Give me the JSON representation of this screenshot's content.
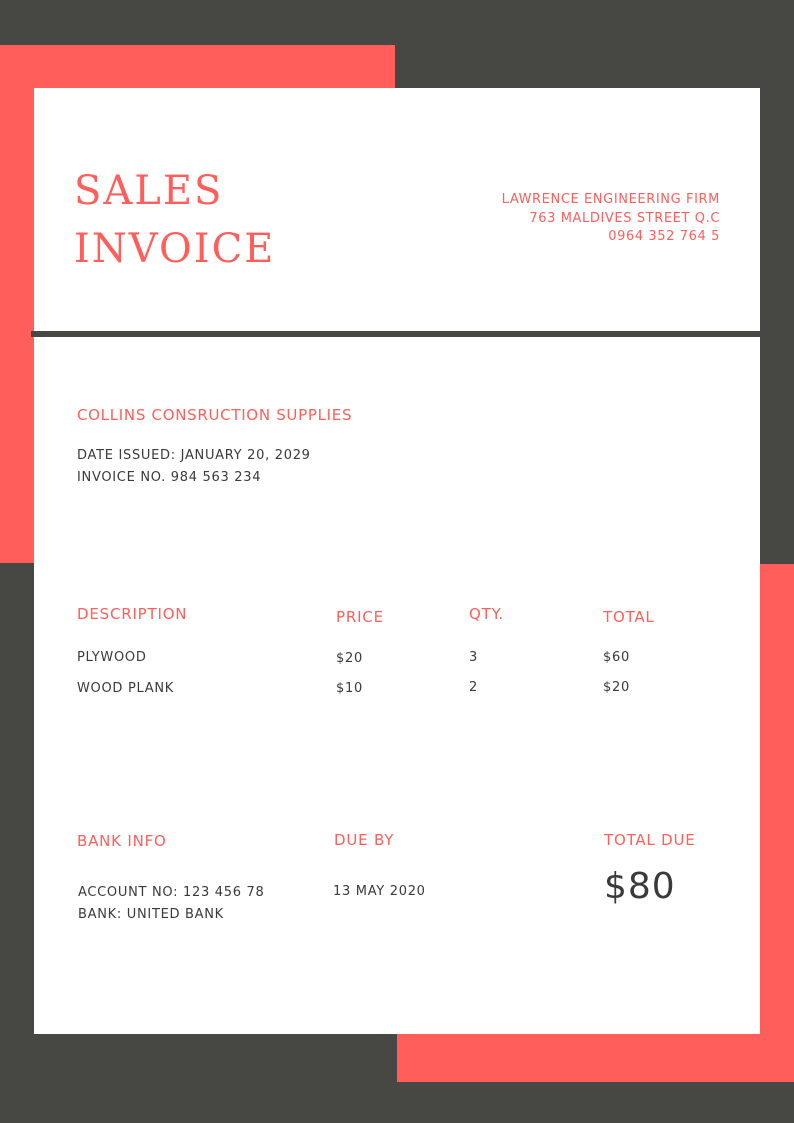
{
  "header": {
    "title_line1": "SALES",
    "title_line2": "INVOICE",
    "company_name": "LAWRENCE ENGINEERING FIRM",
    "company_address": "763 MALDIVES STREET Q.C",
    "company_phone": "0964 352 764 5"
  },
  "client": {
    "name": "COLLINS CONSRUCTION SUPPLIES",
    "date_issued": "DATE ISSUED: JANUARY 20, 2029",
    "invoice_no": "INVOICE NO. 984 563 234"
  },
  "table": {
    "headers": [
      "DESCRIPTION",
      "PRICE",
      "QTY.",
      "TOTAL"
    ],
    "rows": [
      {
        "description": "PLYWOOD",
        "price": "$20",
        "qty": "3",
        "total": "$60"
      },
      {
        "description": "WOOD PLANK",
        "price": "$10",
        "qty": "2",
        "total": "$20"
      }
    ]
  },
  "footer": {
    "bank_heading": "BANK INFO",
    "account": "ACCOUNT NO: 123 456 78",
    "bank": "BANK: UNITED BANK",
    "due_heading": "DUE BY",
    "due_date": "13 MAY 2020",
    "total_heading": "TOTAL DUE",
    "total_amount": "$80"
  },
  "colors": {
    "accent": "#ff5e5b",
    "background": "#474744",
    "paper": "#ffffff",
    "text": "#3a3a3a"
  }
}
